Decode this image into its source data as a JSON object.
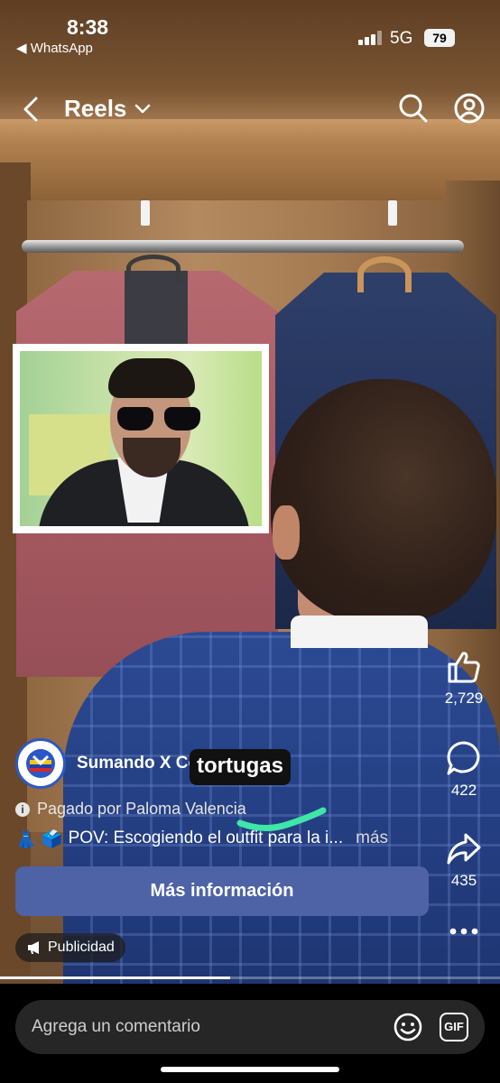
{
  "status_bar": {
    "time": "8:38",
    "back_app": "◀ WhatsApp",
    "network": "5G",
    "battery": "79"
  },
  "nav": {
    "title": "Reels"
  },
  "inset_photo": {
    "depicts": "photo-of-man-with-sunglasses"
  },
  "actions": {
    "like_count": "2,729",
    "comment_count": "422",
    "share_count": "435"
  },
  "post": {
    "account_name": "Sumando X Colombia",
    "sticker_text": "tortugas",
    "paid_by": "Pagado por Paloma Valencia",
    "caption_emojis": "👗 🗳️",
    "caption": "POV: Escogiendo el outfit para la i...",
    "more_label": "más",
    "cta_label": "Más información",
    "ad_badge": "Publicidad"
  },
  "progress": {
    "fraction": 0.46
  },
  "comment_bar": {
    "placeholder": "Agrega un comentario",
    "gif_label": "GIF"
  },
  "colors": {
    "cta": "#4e63a6",
    "avatar_ring": "#2b58c6",
    "scribble": "#3ee6a8"
  }
}
